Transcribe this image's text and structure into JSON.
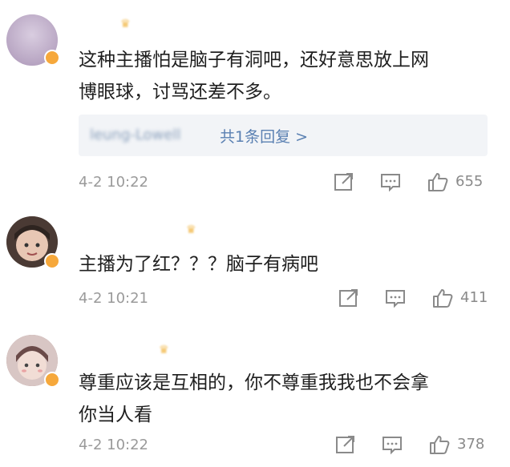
{
  "top_cut_text": "",
  "comments": [
    {
      "username": "",
      "text_lines": [
        "这种主播怕是脑子有洞吧，还好意思放上网",
        "博眼球，讨骂还差不多。"
      ],
      "reply": {
        "user": "leung-Lowell",
        "link": "共1条回复 >"
      },
      "time": "4-2 10:22",
      "likes": "655",
      "avatar_color": "#c8b8cf"
    },
    {
      "username": "",
      "text_lines": [
        "主播为了红？？？脑子有病吧"
      ],
      "time": "4-2 10:21",
      "likes": "411",
      "avatar_color": "#5a4a42"
    },
    {
      "username": "",
      "text_lines": [
        "尊重应该是互相的，你不尊重我我也不会拿",
        "你当人看"
      ],
      "time": "4-2 10:22",
      "likes": "378",
      "avatar_color": "#b99a98"
    }
  ],
  "icons": {
    "share": "share-icon",
    "comment": "comment-icon",
    "like": "thumbs-up-icon",
    "crown": "crown-icon"
  },
  "colors": {
    "link": "#5a80b2",
    "meta": "#9a9a9a",
    "reply_bg": "#f2f4f7"
  }
}
